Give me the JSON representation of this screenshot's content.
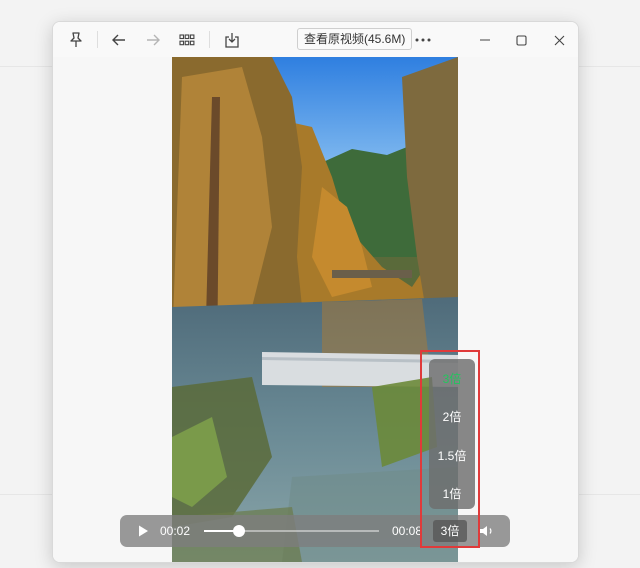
{
  "titlebar": {
    "view_original_label": "查看原视频(45.6M)",
    "icons": [
      "pin-icon",
      "back-arrow-icon",
      "forward-arrow-icon",
      "grid-icon",
      "download-icon",
      "more-icon",
      "minimize-icon",
      "maximize-icon",
      "close-icon"
    ]
  },
  "player": {
    "current_time": "00:02",
    "duration": "00:08",
    "progress_fraction": 0.2,
    "speed_label": "3倍",
    "speed_menu": {
      "options": [
        "3倍",
        "2倍",
        "1.5倍",
        "1倍"
      ],
      "selected": "3倍"
    }
  },
  "colors": {
    "active_speed": "#22c55e",
    "highlight_border": "#e03a3a"
  }
}
